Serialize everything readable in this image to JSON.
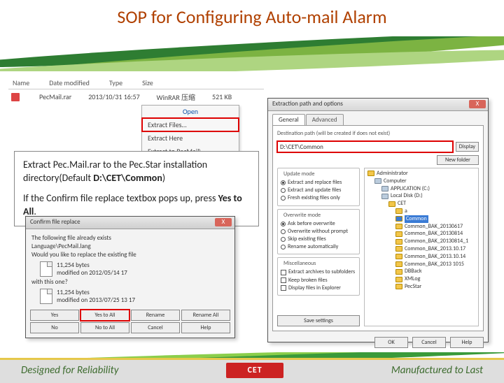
{
  "title": "SOP for Configuring Auto-mail Alarm",
  "explorer": {
    "headers": {
      "name": "Name",
      "date": "Date modified",
      "type": "Type",
      "size": "Size"
    },
    "row": {
      "name": "PecMail.rar",
      "date": "2013/10/31 16:57",
      "type": "WinRAR 压缩",
      "size": "521 KB"
    }
  },
  "ctx": {
    "title": "Open",
    "extract_files": "Extract Files…",
    "extract_here": "Extract Here",
    "extract_to": "Extract to PecMail\\"
  },
  "instr": {
    "line1a": "Extract Pec.Mail.rar to the Pec.Star installation directory(Default ",
    "line1b": "D:\\CET\\Common",
    "line1c": ")",
    "line2a": "If the Confirm file replace textbox pops up, press ",
    "line2b": "Yes to All",
    "line2c": "."
  },
  "confirm": {
    "title": "Confirm file replace",
    "l1": "The following file already exists",
    "l2": "Language\\PecMail.lang",
    "l3": "Would you like to replace the existing file",
    "size": "11,254 bytes",
    "mod1": "modified on 2012/05/14 17",
    "with": "with this one?",
    "mod2": "modified on 2013/07/25 13 17",
    "btn_yes": "Yes",
    "btn_yes_all": "Yes to All",
    "btn_rename": "Rename",
    "btn_rename_all": "Rename All",
    "btn_no": "No",
    "btn_no_all": "No to All",
    "btn_cancel": "Cancel",
    "btn_help": "Help"
  },
  "ext": {
    "title": "Extraction path and options",
    "tab_general": "General",
    "tab_advanced": "Advanced",
    "path_label": "Destination path (will be created if does not exist)",
    "path_value": "D:\\CET\\Common",
    "display": "Display",
    "newfolder": "New folder",
    "upd": {
      "title": "Update mode",
      "r1": "Extract and replace files",
      "r2": "Extract and update files",
      "r3": "Fresh existing files only"
    },
    "ovr": {
      "title": "Overwrite mode",
      "r1": "Ask before overwrite",
      "r2": "Overwrite without prompt",
      "r3": "Skip existing files",
      "r4": "Rename automatically"
    },
    "misc": {
      "title": "Miscellaneous",
      "c1": "Extract archives to subfolders",
      "c2": "Keep broken files",
      "c3": "Display files in Explorer"
    },
    "save": "Save settings",
    "ok": "OK",
    "cancel": "Cancel",
    "help": "Help",
    "tree": {
      "root": "Administrator",
      "computer": "Computer",
      "c": "APPLICATION (C:)",
      "d": "Local Disk (D:)",
      "cet": "CET",
      "a": "a",
      "comm": "Common",
      "b1": "Common_BAK_20130617",
      "b2": "Common_BAK_20130814",
      "b3": "Common_BAK_20130814_1",
      "b4": "Common_BAK_2013.10.17",
      "b5": "Common_BAK_2013.10.14",
      "b6": "Common_BAK_2013 1015",
      "db": "DBBack",
      "xml": "XMLog",
      "ps": "PecStar"
    }
  },
  "footer": {
    "left": "Designed for Reliability",
    "logo": "CET",
    "right": "Manufactured to Last"
  }
}
